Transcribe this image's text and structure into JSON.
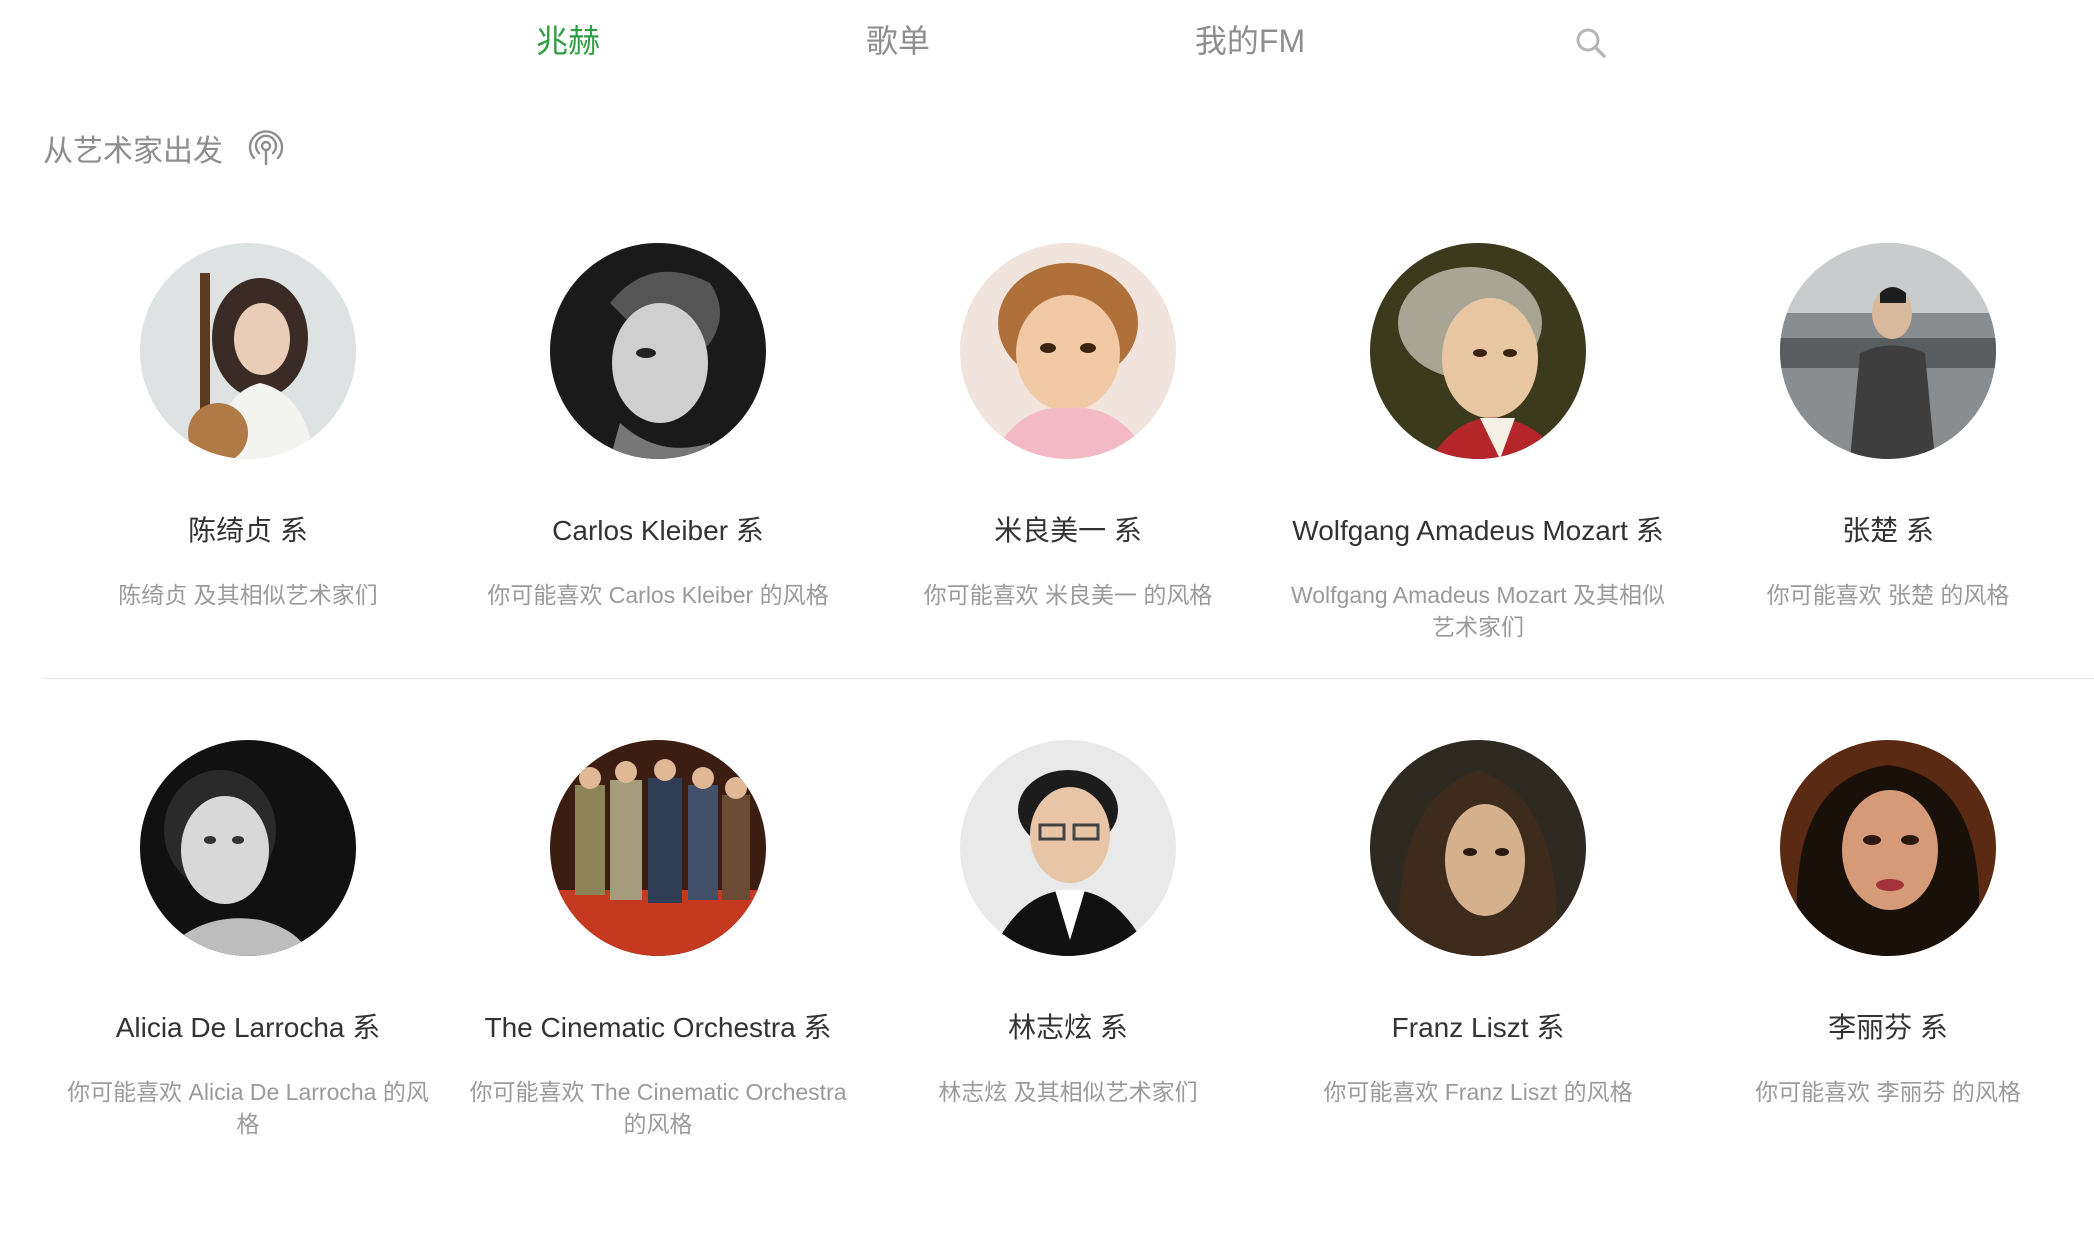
{
  "nav": {
    "tabs": [
      {
        "label": "兆赫",
        "active": true
      },
      {
        "label": "歌单",
        "active": false
      },
      {
        "label": "我的FM",
        "active": false
      }
    ],
    "search_icon": "search-icon",
    "active_color": "#2f9e45"
  },
  "section": {
    "title": "从艺术家出发",
    "icon": "radio-signal-icon"
  },
  "artists": [
    {
      "name": "陈绮贞 系",
      "desc": "陈绮贞 及其相似艺术家们"
    },
    {
      "name": "Carlos Kleiber 系",
      "desc": "你可能喜欢 Carlos Kleiber 的风格"
    },
    {
      "name": "米良美一 系",
      "desc": "你可能喜欢 米良美一 的风格"
    },
    {
      "name": "Wolfgang Amadeus Mozart 系",
      "desc": "Wolfgang Amadeus Mozart 及其相似艺术家们"
    },
    {
      "name": "张楚 系",
      "desc": "你可能喜欢 张楚 的风格"
    },
    {
      "name": "Alicia De Larrocha 系",
      "desc": "你可能喜欢 Alicia De Larrocha 的风格"
    },
    {
      "name": "The Cinematic Orchestra 系",
      "desc": "你可能喜欢 The Cinematic Orchestra 的风格"
    },
    {
      "name": "林志炫 系",
      "desc": "林志炫 及其相似艺术家们"
    },
    {
      "name": "Franz Liszt 系",
      "desc": "你可能喜欢 Franz Liszt 的风格"
    },
    {
      "name": "李丽芬 系",
      "desc": "你可能喜欢 李丽芬 的风格"
    }
  ]
}
